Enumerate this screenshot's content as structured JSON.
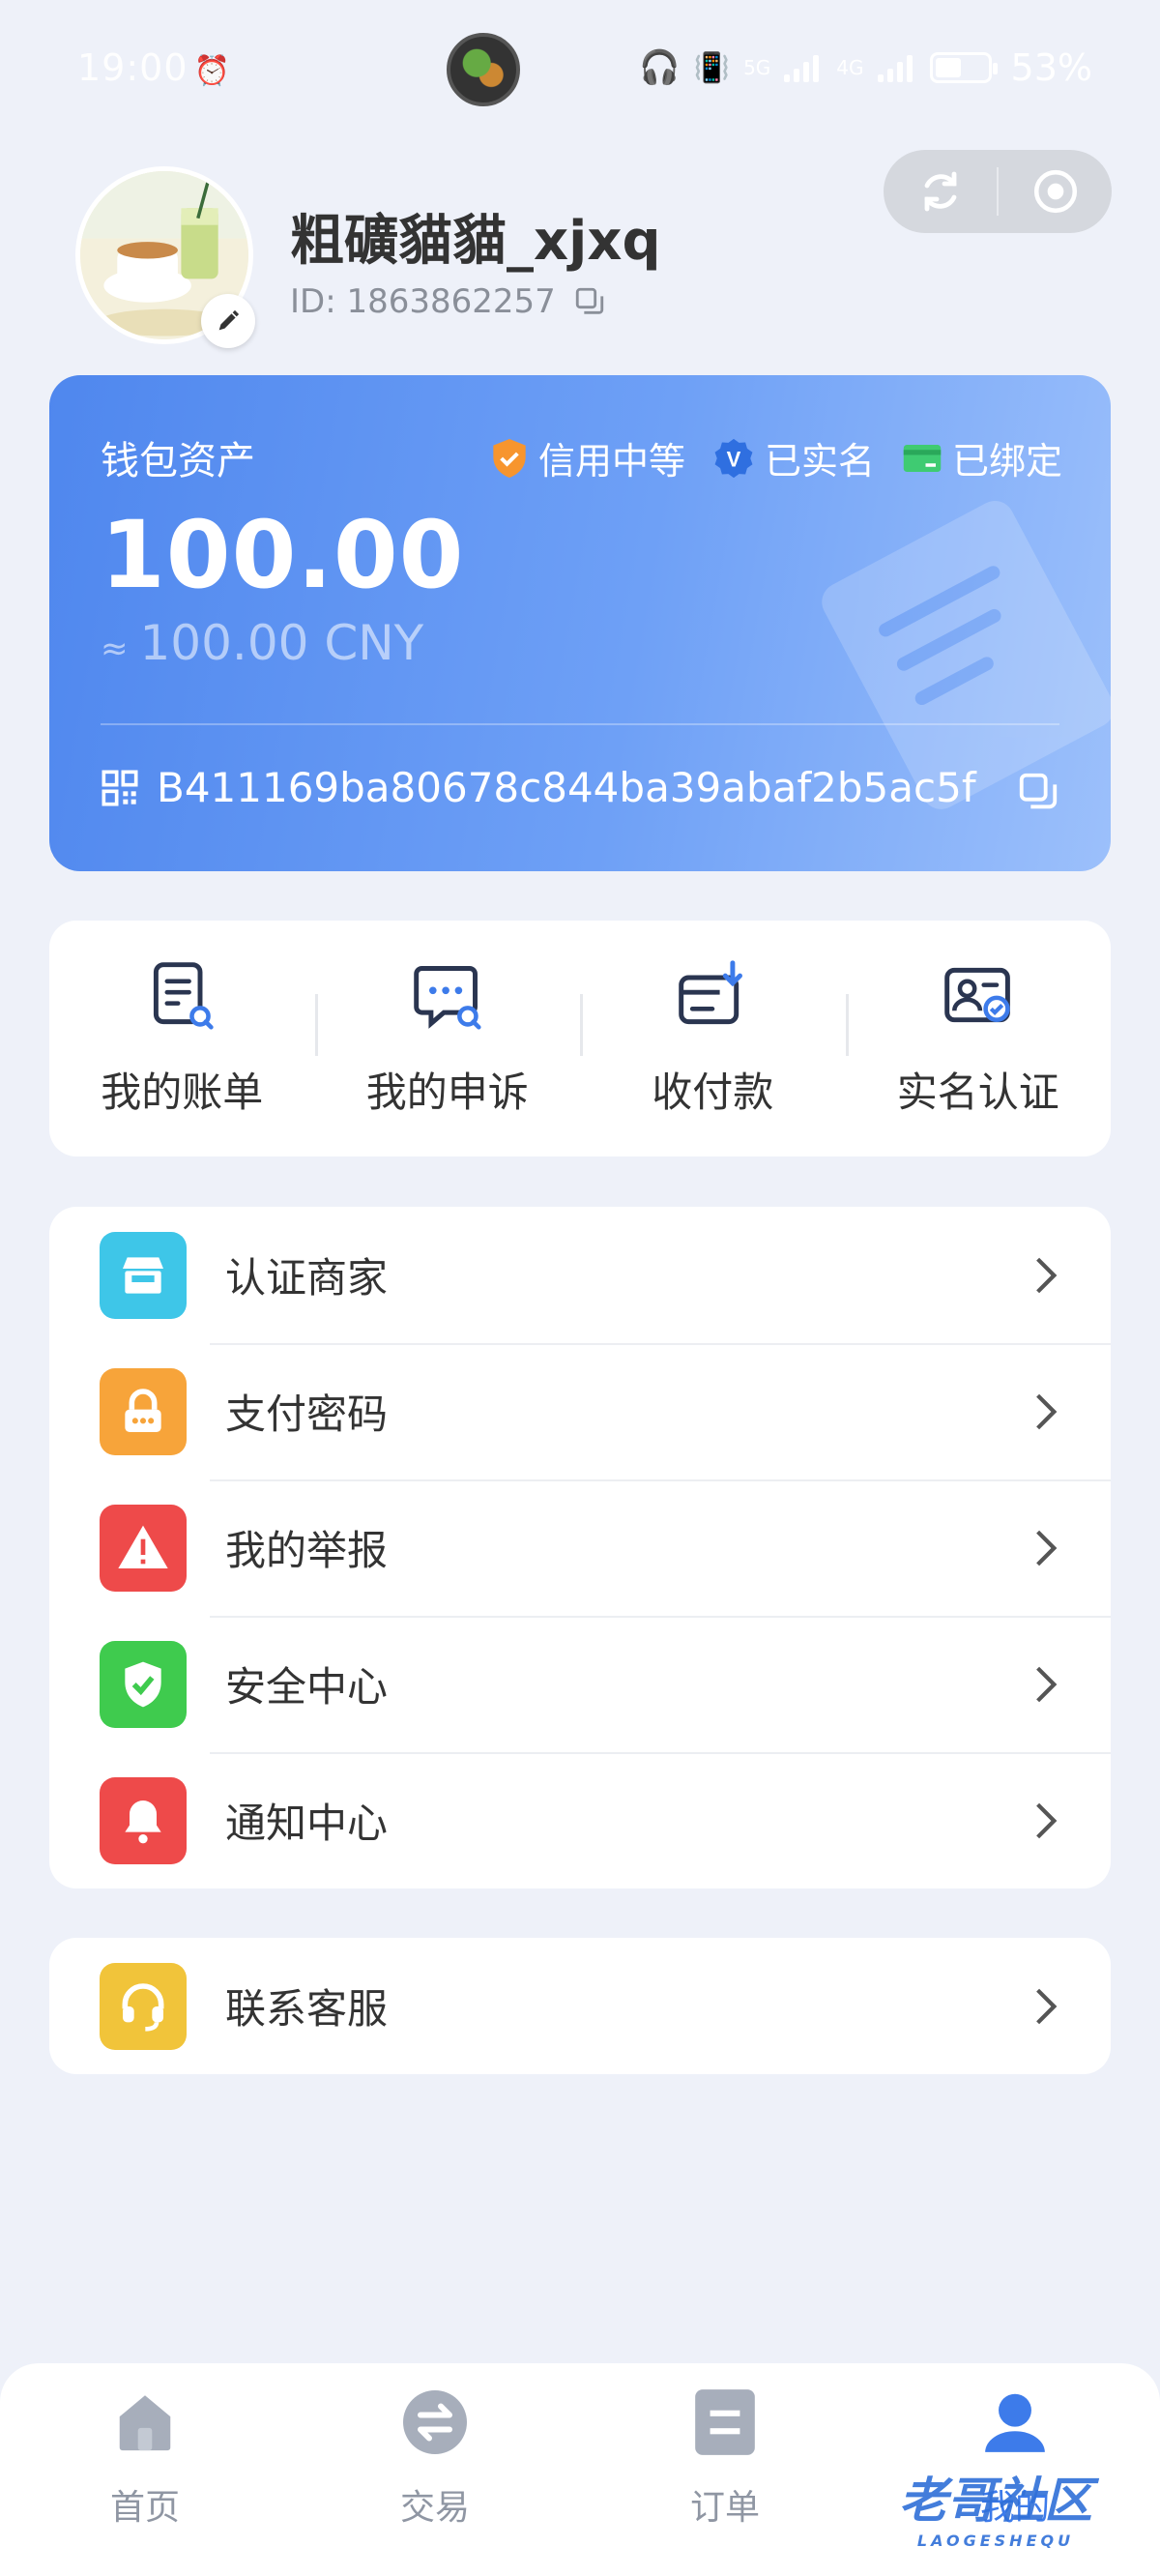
{
  "status_bar": {
    "time": "19:00",
    "network_1": "5G",
    "network_2": "4G",
    "battery": "53%"
  },
  "profile": {
    "username": "粗礦貓貓_xjxq",
    "id_label": "ID: 1863862257"
  },
  "wallet": {
    "title": "钱包资产",
    "badges": {
      "credit": "信用中等",
      "verified": "已实名",
      "bound": "已绑定"
    },
    "verified_mark": "V",
    "amount": "100.00",
    "approx": "≈",
    "cny_amount": "100.00 CNY",
    "address": "B411169ba80678c844ba39abaf2b5ac5f"
  },
  "quick_actions": [
    {
      "label": "我的账单",
      "icon": "bill-search-icon"
    },
    {
      "label": "我的申诉",
      "icon": "chat-search-icon"
    },
    {
      "label": "收付款",
      "icon": "card-receive-icon"
    },
    {
      "label": "实名认证",
      "icon": "id-verify-icon"
    }
  ],
  "menu": [
    {
      "label": "认证商家",
      "icon": "store-icon",
      "color": "#3ec6e8"
    },
    {
      "label": "支付密码",
      "icon": "lock-icon",
      "color": "#f7a43a"
    },
    {
      "label": "我的举报",
      "icon": "warning-icon",
      "color": "#ee4a4a"
    },
    {
      "label": "安全中心",
      "icon": "shield-check-icon",
      "color": "#3fcb4e"
    },
    {
      "label": "通知中心",
      "icon": "bell-icon",
      "color": "#ee4a4a"
    }
  ],
  "support": {
    "label": "联系客服",
    "icon": "headset-icon",
    "color": "#f1c43a"
  },
  "bottom_nav": [
    {
      "label": "首页",
      "icon": "home-icon",
      "active": false
    },
    {
      "label": "交易",
      "icon": "exchange-icon",
      "active": false
    },
    {
      "label": "订单",
      "icon": "order-icon",
      "active": false
    },
    {
      "label": "我的",
      "icon": "user-icon",
      "active": true
    }
  ],
  "watermark": {
    "text": "老哥社区",
    "sub": "LAOGESHEQU"
  },
  "colors": {
    "accent": "#3d7bea",
    "background": "#eef1f9"
  }
}
